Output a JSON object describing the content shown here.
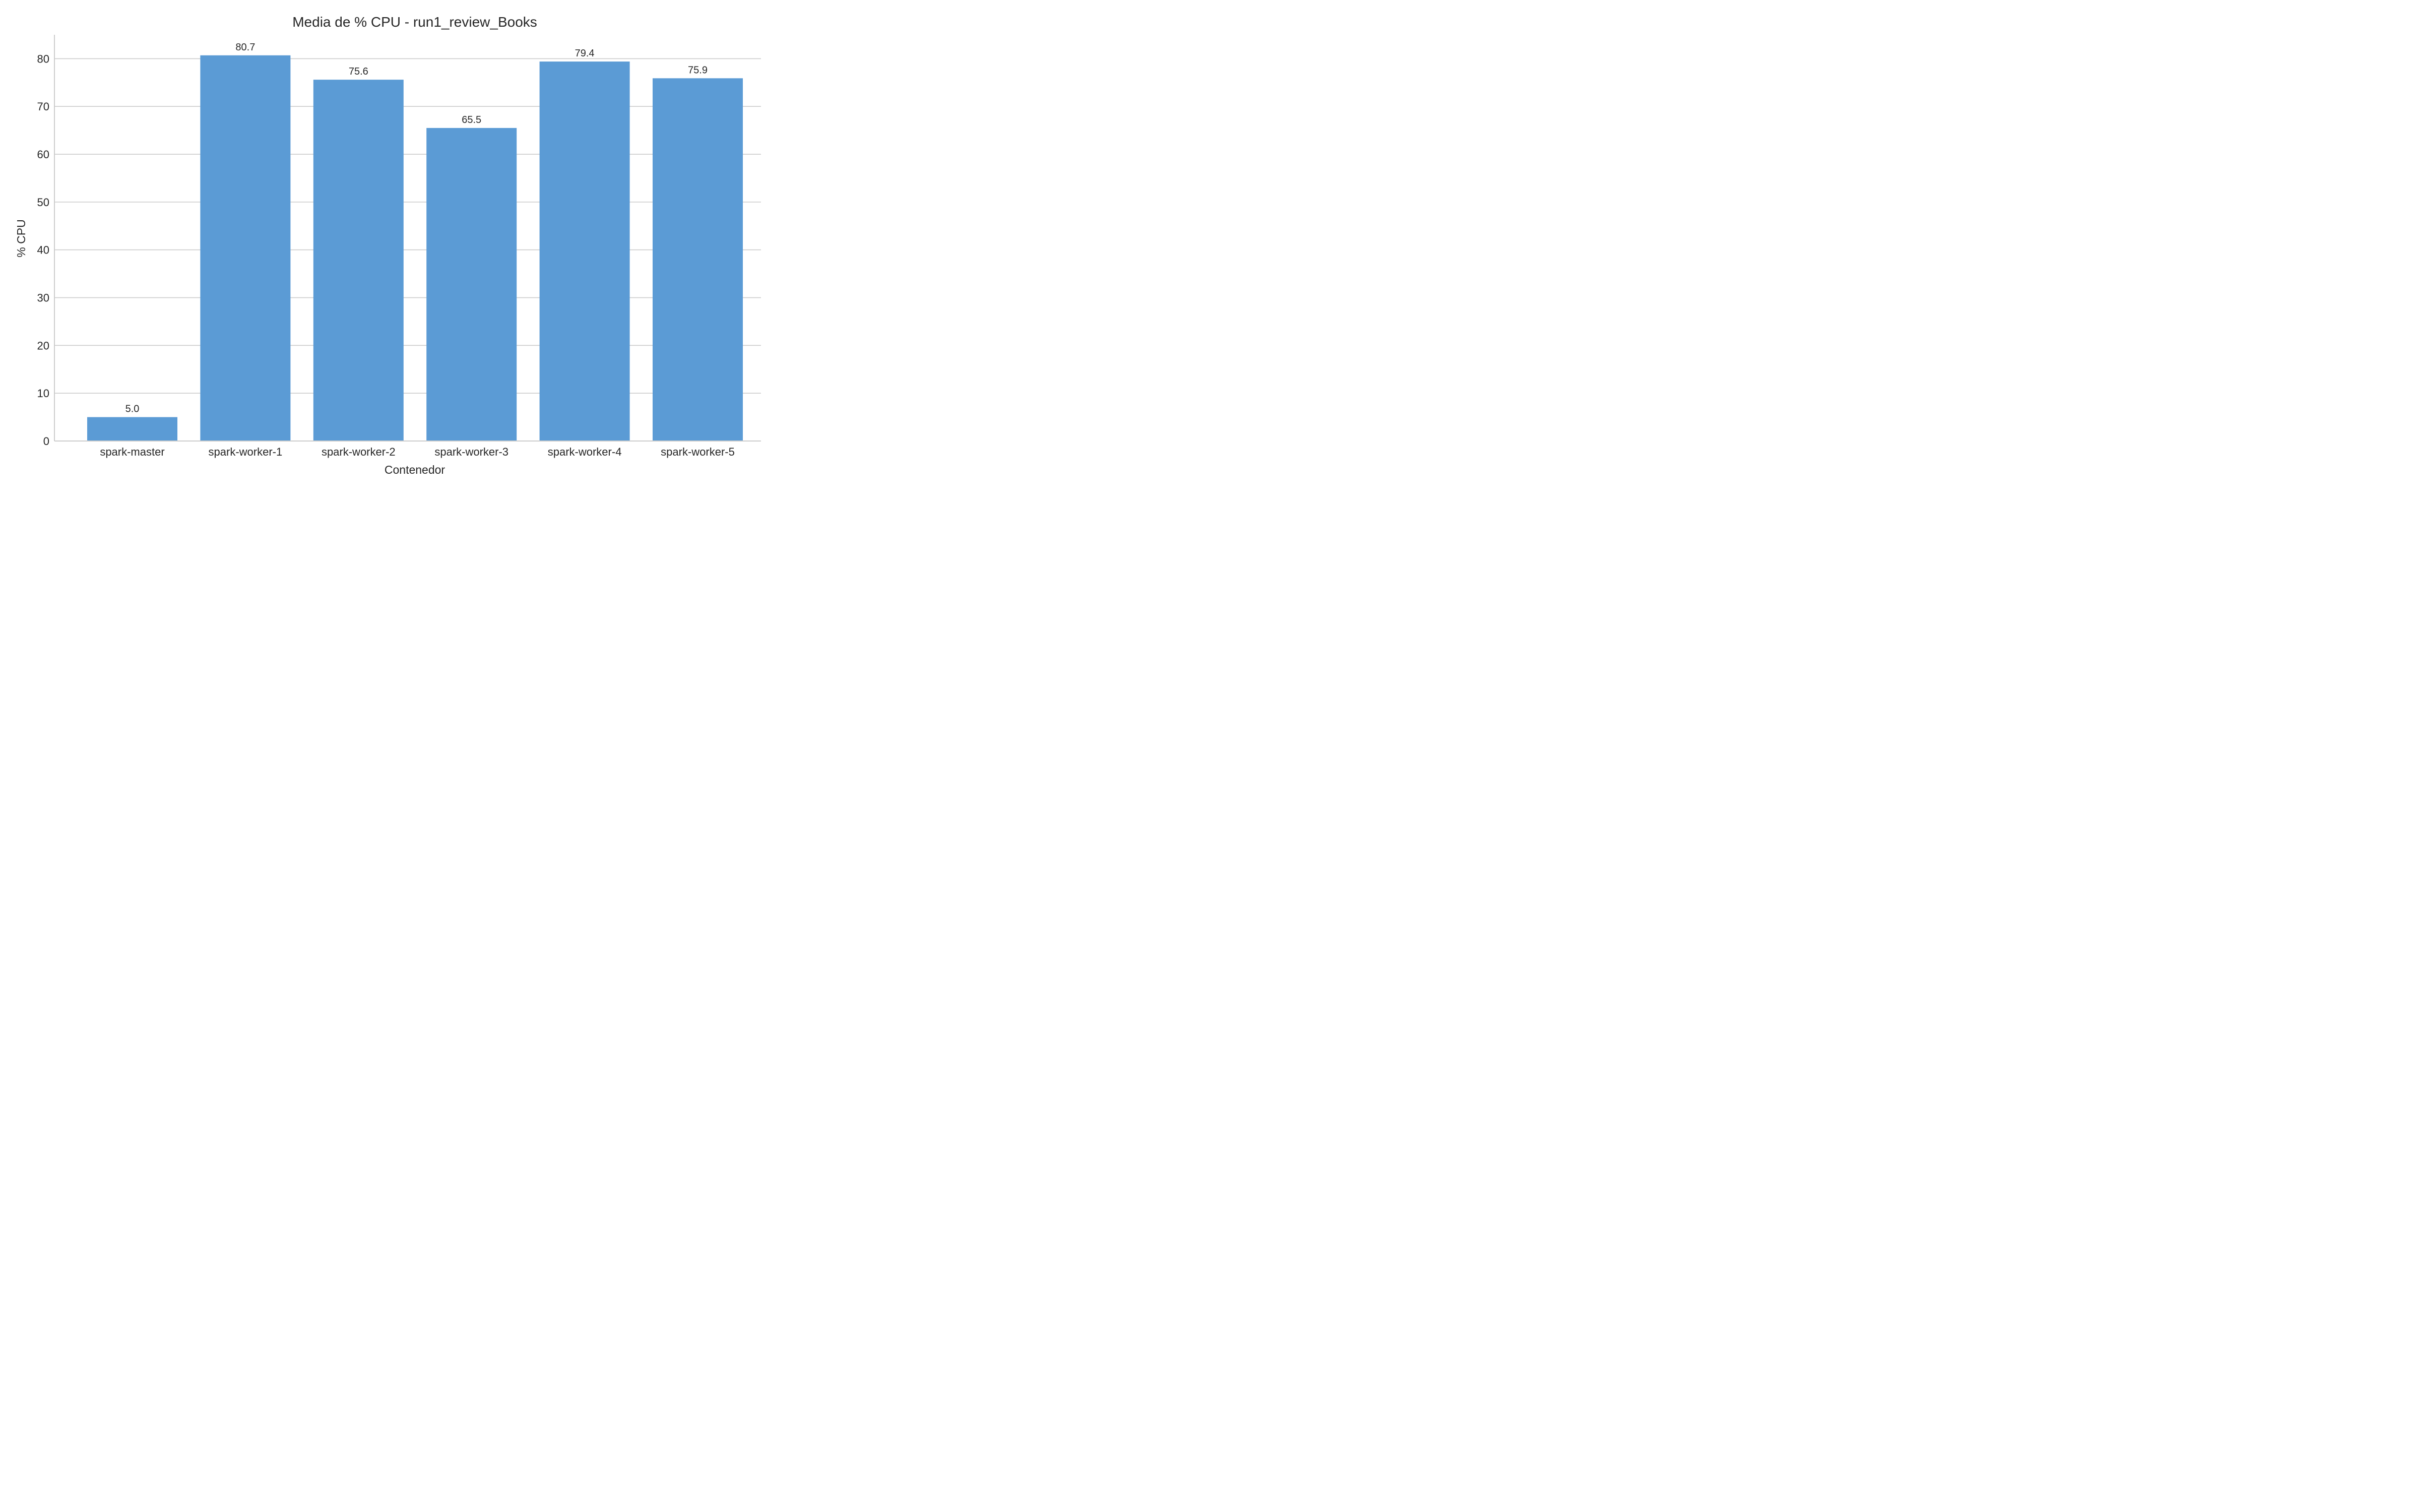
{
  "chart_data": {
    "type": "bar",
    "title": "Media de % CPU - run1_review_Books",
    "xlabel": "Contenedor",
    "ylabel": "% CPU",
    "categories": [
      "spark-master",
      "spark-worker-1",
      "spark-worker-2",
      "spark-worker-3",
      "spark-worker-4",
      "spark-worker-5"
    ],
    "values": [
      5.0,
      80.7,
      75.6,
      65.5,
      79.4,
      75.9
    ],
    "data_labels": [
      "5.0",
      "80.7",
      "75.6",
      "65.5",
      "79.4",
      "75.9"
    ],
    "ylim": [
      0,
      85
    ],
    "yticks": [
      0,
      10,
      20,
      30,
      40,
      50,
      60,
      70,
      80
    ],
    "grid": "horizontal",
    "legend": "none",
    "bar_color": "#5b9bd5"
  }
}
